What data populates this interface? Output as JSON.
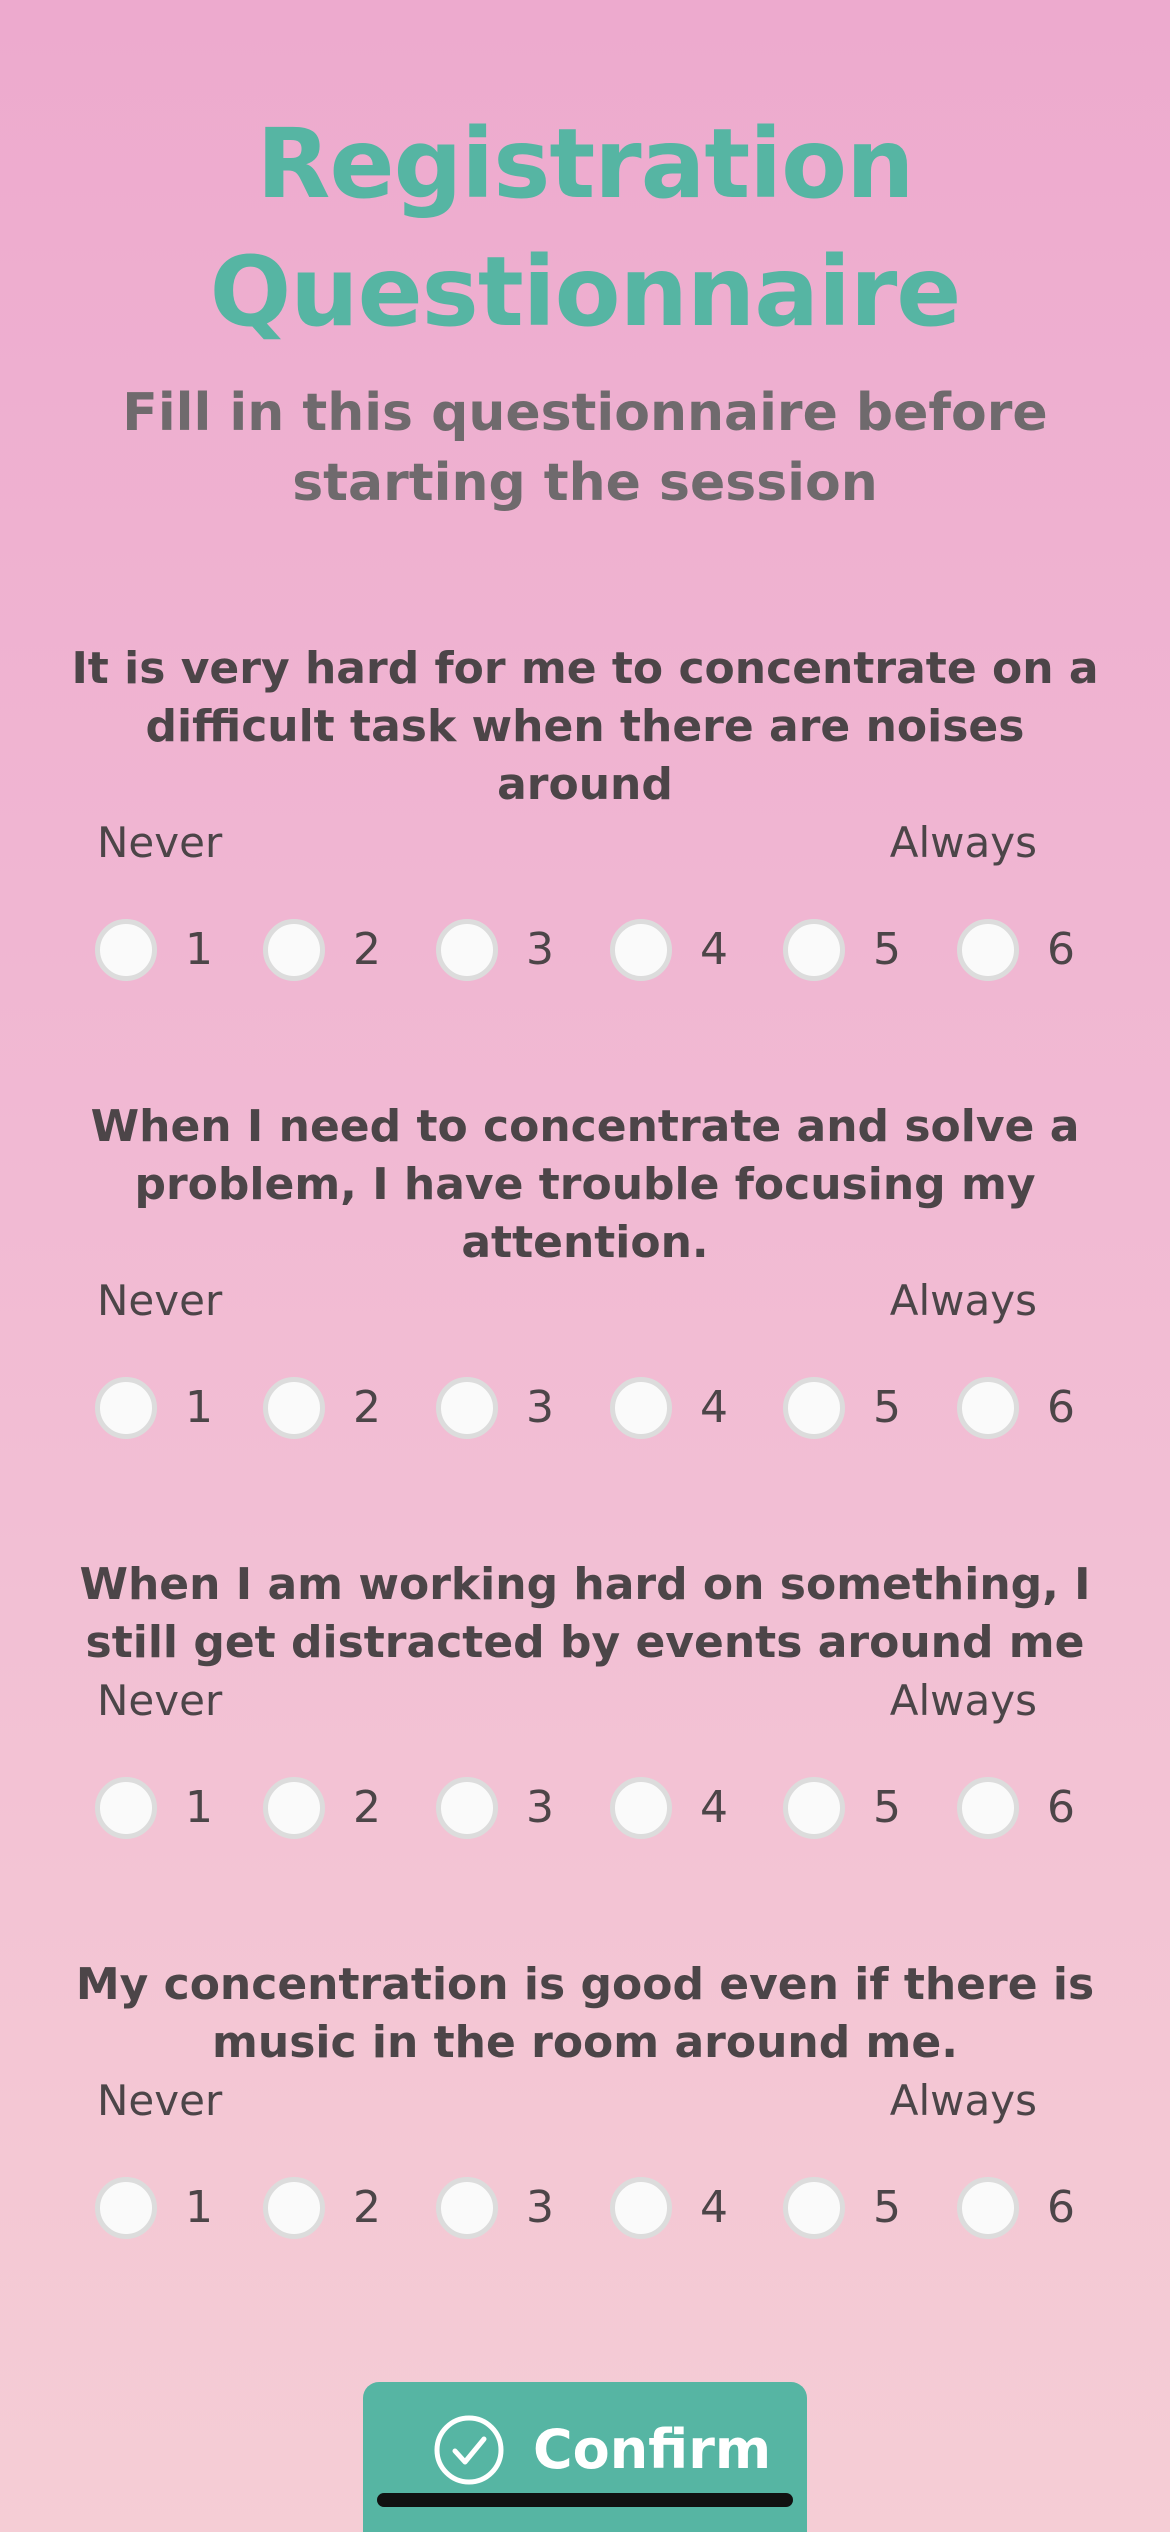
{
  "header": {
    "title_line1": "Registration",
    "title_line2": "Questionnaire",
    "subtitle": "Fill in this questionnaire before starting the session"
  },
  "scale": {
    "low_label": "Never",
    "high_label": "Always",
    "options": [
      "1",
      "2",
      "3",
      "4",
      "5",
      "6"
    ]
  },
  "questions": [
    {
      "text": "It is very hard for me to concentrate on a difficult task when there are noises around"
    },
    {
      "text": "When I need to concentrate and solve a problem, I have trouble focusing my attention."
    },
    {
      "text": "When I am working hard on something, I still get distracted by events around me"
    },
    {
      "text": "My concentration is good even if there is music in the room around me."
    }
  ],
  "confirm_button": {
    "label": "Confirm",
    "icon": "check-circle-icon"
  },
  "colors": {
    "accent": "#56b5a3",
    "text": "#4c4548",
    "subtitle": "#6f6a6d",
    "background_top": "#edaace",
    "background_bottom": "#f5cdd5"
  }
}
